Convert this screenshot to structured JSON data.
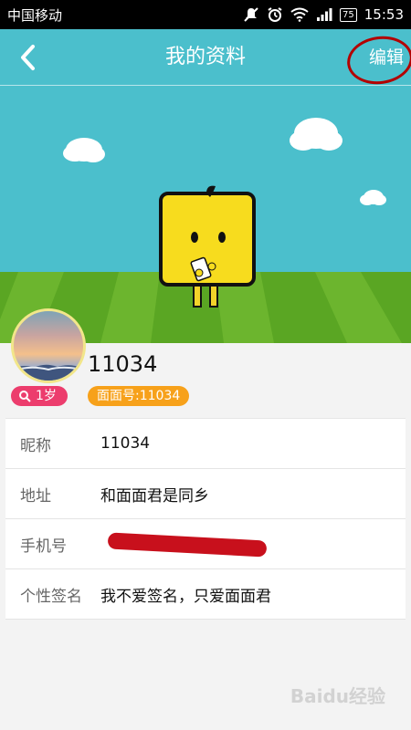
{
  "statusbar": {
    "carrier": "中国移动",
    "battery": "75",
    "time": "15:53"
  },
  "header": {
    "title": "我的资料",
    "edit_label": "编辑"
  },
  "profile": {
    "nickname": "11034",
    "age": "1岁",
    "id_badge": "面面号:11034"
  },
  "info": {
    "rows": [
      {
        "label": "昵称",
        "value": "11034"
      },
      {
        "label": "地址",
        "value": "和面面君是同乡"
      },
      {
        "label": "手机号",
        "value": ""
      },
      {
        "label": "个性签名",
        "value": "我不爱签名，只爱面面君"
      }
    ]
  },
  "watermark": "Baidu经验",
  "colors": {
    "header": "#4bbfcc",
    "age_badge": "#ec3d6d",
    "id_badge": "#f7a11a"
  }
}
